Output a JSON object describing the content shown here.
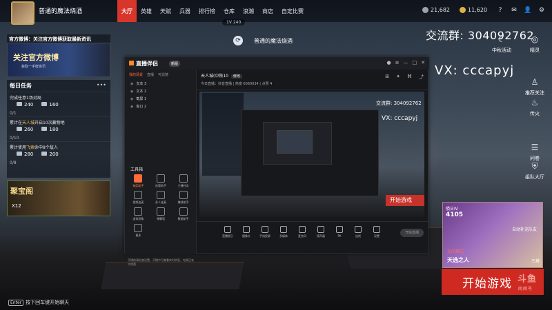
{
  "player": {
    "name": "普通的魔法烧酒"
  },
  "nav": {
    "items": [
      "大厅",
      "英雄",
      "天赋",
      "兵器",
      "排行榜",
      "仓库",
      "浪潮",
      "商店",
      "自定比赛"
    ],
    "active_index": 0
  },
  "version": "1V 240",
  "currency": {
    "gold": "21,682",
    "coins": "11,620"
  },
  "top_icons": [
    "?",
    "✉",
    "👤",
    "⚙"
  ],
  "left_panel": {
    "notice": "官方微博：关注官方微博获取最新资讯",
    "banner_title": "关注官方微博",
    "banner_sub": "获取一手鲜资讯",
    "daily_title": "每日任务",
    "more": "•••",
    "tasks": [
      {
        "desc_pre": "完成任意1场对局",
        "desc_hl": "",
        "desc_post": "",
        "r1": "240",
        "r2": "160",
        "progress": "0/1"
      },
      {
        "desc_pre": "累计在",
        "desc_hl": "天人城",
        "desc_post": "开启10次藏物地",
        "r1": "260",
        "r2": "180",
        "progress": "0/10"
      },
      {
        "desc_pre": "累计使用",
        "desc_hl": "飞索",
        "desc_post": "命中8个敌人",
        "r1": "280",
        "r2": "200",
        "progress": "0/8"
      }
    ],
    "treasure_title": "聚宝阁",
    "treasure_count": "X12"
  },
  "chat_hint": {
    "key": "Enter",
    "text": "按下回车键开始聊天"
  },
  "center_name": "普通的魔法烧酒",
  "overlay": {
    "qq": "交流群:   304092762",
    "vx": "VX:   cccapyj"
  },
  "right_icons": [
    {
      "label": "中秋活动",
      "icon": "moon-icon",
      "glyph": "☾"
    },
    {
      "label": "精灵",
      "icon": "headset-icon",
      "glyph": "◎"
    },
    {
      "label": "推荐关注",
      "icon": "person-icon",
      "glyph": "♙"
    },
    {
      "label": "传火",
      "icon": "flame-icon",
      "glyph": "♨"
    },
    {
      "label": "问卷",
      "icon": "survey-icon",
      "glyph": "☰"
    },
    {
      "label": "组队大厅",
      "icon": "shield-icon",
      "glyph": "⛨"
    }
  ],
  "live_window": {
    "logo": "直播伴侣",
    "badge": "新版",
    "tabs": [
      "我的场景",
      "直播",
      "可滤镜"
    ],
    "sources": [
      "文本 3",
      "文本 2",
      "截屏 1",
      "窗口 2"
    ],
    "tools_title": "工具箱",
    "tools": [
      "抽奖助手",
      "房管助手",
      "主播任务",
      "视频连麦",
      "多人连麦",
      "赚钱助手",
      "虚拟形象",
      "弹幕墙",
      "数据助手",
      "更多"
    ],
    "bottom_tip": "开播前请检查设置，开播中可查看实时消息，电视还有大惊喜",
    "room": "天人城(中秋10",
    "room_edit": "修改",
    "meta": "今日直播：抖音直播  | 热度 6060034  | 点赞 4",
    "controls": [
      "直播提示",
      "摄像头",
      "手机投屏",
      "多媒体",
      "麦克风",
      "扬声器",
      "PK",
      "连线",
      "设置"
    ],
    "start_live": "开始直播",
    "preview_qq": "交流群: 304092762",
    "preview_vx": "VX: cccapyj",
    "preview_start": "开始游戏"
  },
  "mode_card": {
    "rank": "陨日IV",
    "score": "4105",
    "side": "自动补充队友",
    "sub": "无间模式",
    "name": "天选之人",
    "people": "三排"
  },
  "start_game": "开始游戏",
  "brand": {
    "tag": "斗鱼",
    "sub": "闹闹号"
  }
}
